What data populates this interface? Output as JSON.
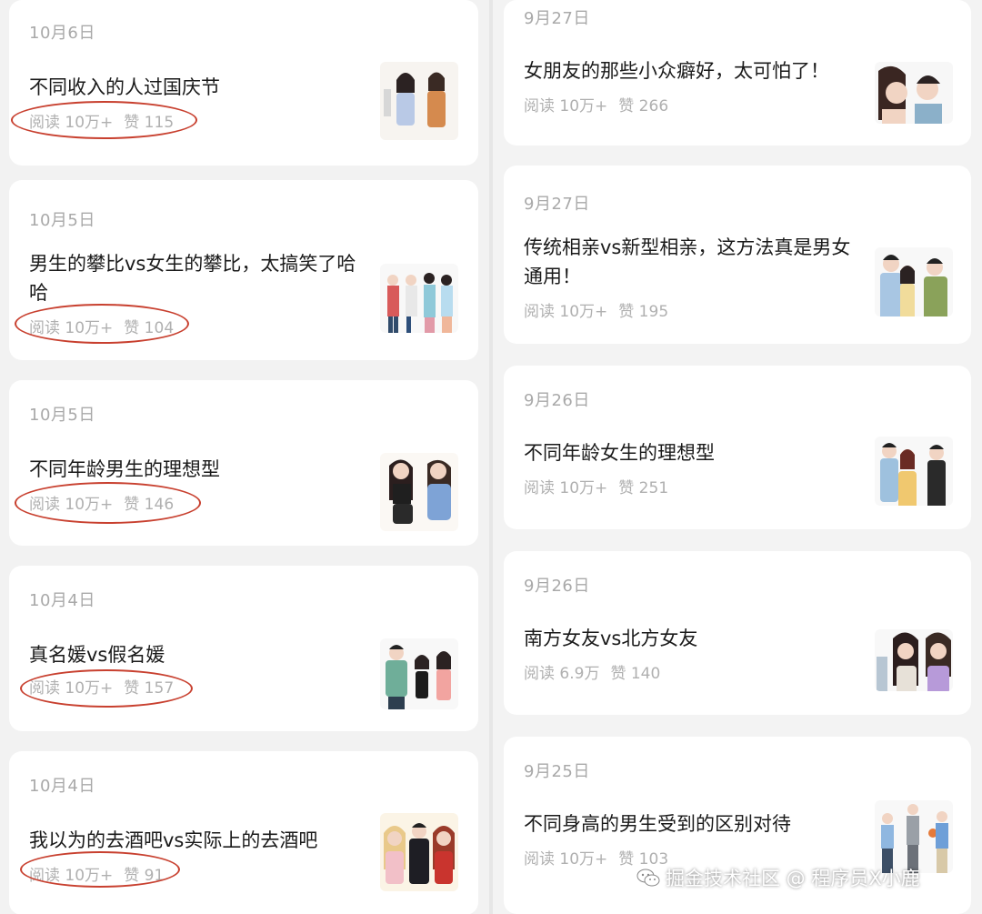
{
  "left_column": {
    "articles": [
      {
        "date": "10月6日",
        "title": "不同收入的人过国庆节",
        "read": "阅读 10万+",
        "likes": "赞 115",
        "thumbnail": "illustration-two-women"
      },
      {
        "date": "10月5日",
        "title": "男生的攀比vs女生的攀比，太搞笑了哈哈",
        "read": "阅读 10万+",
        "likes": "赞 104",
        "thumbnail": "illustration-group-of-people"
      },
      {
        "date": "10月5日",
        "title": "不同年龄男生的理想型",
        "read": "阅读 10万+",
        "likes": "赞 146",
        "thumbnail": "illustration-two-women"
      },
      {
        "date": "10月4日",
        "title": "真名媛vs假名媛",
        "read": "阅读 10万+",
        "likes": "赞 157",
        "thumbnail": "illustration-man-and-women"
      },
      {
        "date": "10月4日",
        "title": "我以为的去酒吧vs实际上的去酒吧",
        "read": "阅读 10万+",
        "likes": "赞 91",
        "thumbnail": "illustration-bar-group"
      }
    ]
  },
  "right_column": {
    "articles": [
      {
        "date": "9月27日",
        "title": "女朋友的那些小众癖好，太可怕了！",
        "read": "阅读 10万+",
        "likes": "赞 266",
        "thumbnail": "illustration-couple"
      },
      {
        "date": "9月27日",
        "title": "传统相亲vs新型相亲，这方法真是男女通用！",
        "read": "阅读 10万+",
        "likes": "赞 195",
        "thumbnail": "illustration-couple"
      },
      {
        "date": "9月26日",
        "title": "不同年龄女生的理想型",
        "read": "阅读 10万+",
        "likes": "赞 251",
        "thumbnail": "illustration-couple"
      },
      {
        "date": "9月26日",
        "title": "南方女友vs北方女友",
        "read": "阅读 6.9万",
        "likes": "赞 140",
        "thumbnail": "illustration-two-women"
      },
      {
        "date": "9月25日",
        "title": "不同身高的男生受到的区别对待",
        "read": "阅读 10万+",
        "likes": "赞 103",
        "thumbnail": "illustration-men-standing"
      }
    ]
  },
  "watermark": {
    "text": "掘金技术社区 @ 程序员X小鹿",
    "icon": "wechat-icon"
  },
  "colors": {
    "highlight_oval": "#c8402f",
    "card_bg": "#ffffff",
    "page_bg": "#f2f2f2",
    "meta_text": "#b0b0b0"
  }
}
